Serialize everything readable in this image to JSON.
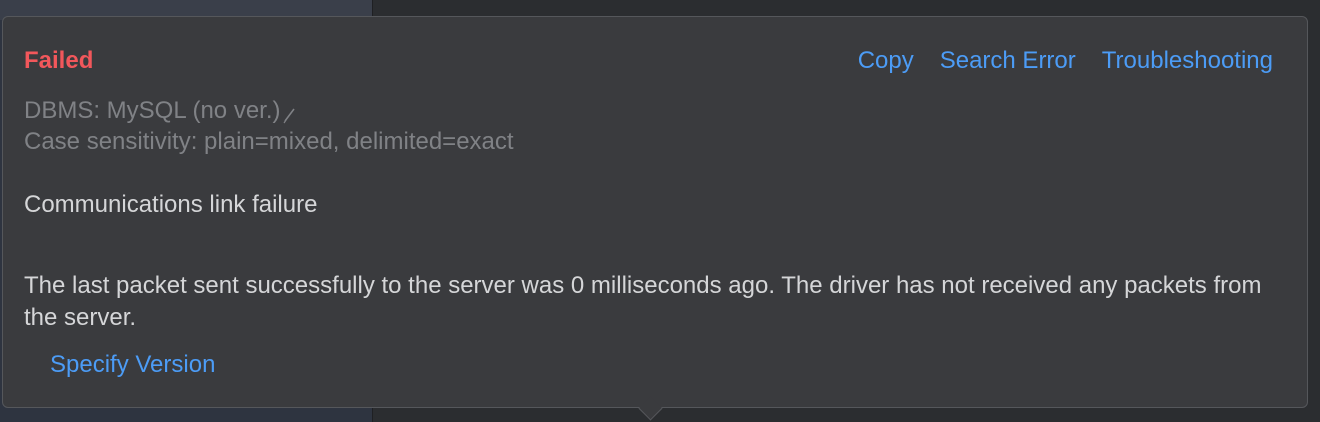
{
  "dialog": {
    "status": "Failed",
    "actions": {
      "copy": "Copy",
      "search_error": "Search Error",
      "troubleshooting": "Troubleshooting"
    },
    "meta": {
      "dbms": "DBMS: MySQL (no ver.)",
      "case_sensitivity": "Case sensitivity: plain=mixed, delimited=exact"
    },
    "error_title": "Communications link failure",
    "error_detail": "The last packet sent successfully to the server was 0 milliseconds ago. The driver has not received any packets from the server.",
    "specify_version": "Specify Version"
  },
  "colors": {
    "status_red": "#f2575b",
    "link_blue": "#4c9cf6",
    "popup_bg": "#3a3b3e",
    "meta_gray": "#808286",
    "text": "#d5d6d8"
  }
}
